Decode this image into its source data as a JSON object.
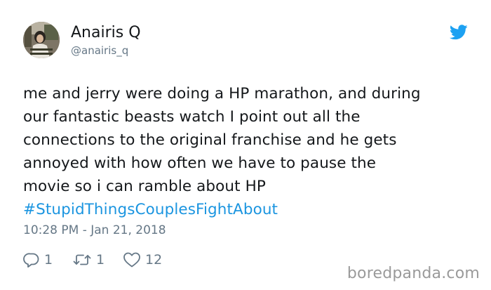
{
  "author": {
    "name": "Anairis Q",
    "handle": "@anairis_q",
    "avatar_icon": "user-avatar-photo"
  },
  "platform_icon": "twitter-bird-icon",
  "colors": {
    "link": "#1b95e0",
    "secondary_text": "#657786",
    "primary_text": "#14171a",
    "bird": "#1da1f2",
    "watermark": "#9a9a9a"
  },
  "tweet": {
    "lines": [
      "me and jerry were doing a HP marathon, and during",
      "our fantastic beasts watch I point out all the",
      "connections to the original franchise and he gets",
      "annoyed with how often we have to pause the",
      "movie so i can ramble about HP"
    ],
    "hashtag": "#StupidThingsCouplesFightAbout"
  },
  "timestamp": "10:28 PM - Jan 21, 2018",
  "actions": {
    "reply": {
      "icon": "reply-icon",
      "count": "1"
    },
    "retweet": {
      "icon": "retweet-icon",
      "count": "1"
    },
    "like": {
      "icon": "heart-icon",
      "count": "12"
    }
  },
  "watermark": "boredpanda.com"
}
